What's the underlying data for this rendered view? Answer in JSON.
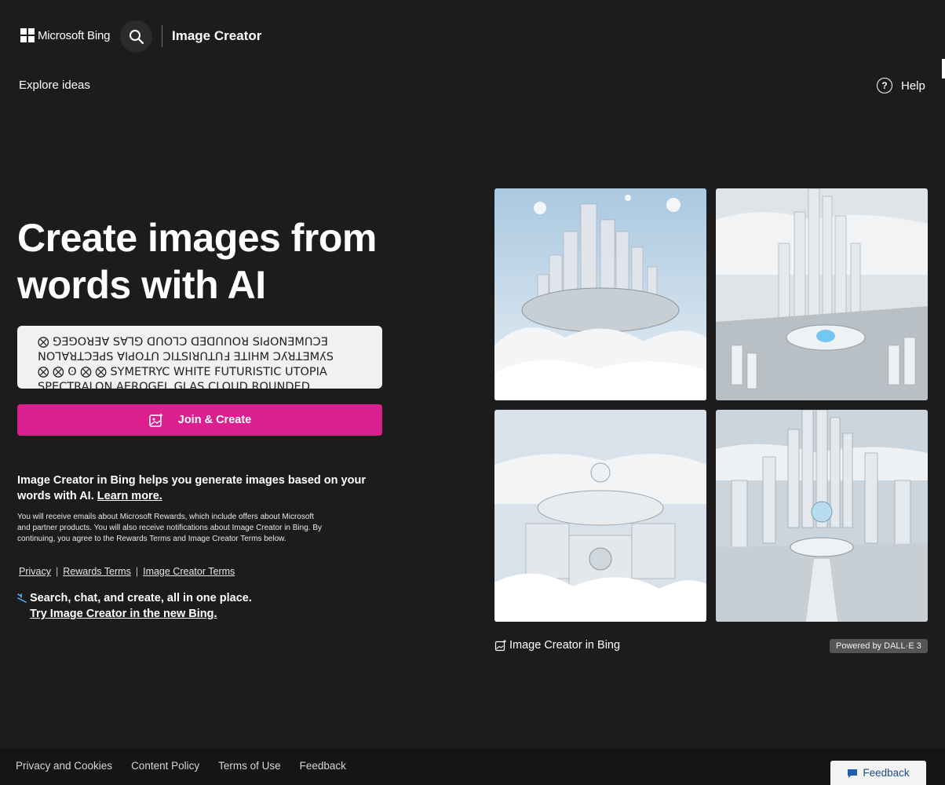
{
  "header": {
    "logo_text": "Microsoft Bing",
    "title": "Image Creator",
    "search_icon": "search-icon"
  },
  "nav": {
    "explore": "Explore ideas",
    "help": "Help",
    "help_icon": "question-circle-icon"
  },
  "hero": {
    "title": "Create images from words with AI",
    "prompt_text": "⨂ ꓣIꓕꓤꓣꓰꓕꓒꓖꓢ ꓮꓢꓤꓢ ꓛꓤꓴꓵꓓ ꓣꓴꓵꓓꓰꓓ ꓣꓛꓴꓟꓰꓠꓴꓑꓤꓲꓢ ꓚꓲꓩꓷ ꓡꓯꓠ ꓤꓲꓢꓢ ꓢꓲꓛꓨꓕꓣꓬꓲꓥ ꓠꓲꓥꓢꓕꓛꓬ ⨂ ⨂ ʘ ⨂ ⨂ SYMETRYC WHITE FUTURISTIC UTOPIA SPECTRALON AEROGEL GLAS CLOUD ROUNDED",
    "prompt_line1": "⨂ ⅁ƎꓨOꓤƎⱯ S∀ꓶ⅁ ꓷꓵOꓶƆ ꓷƎꓷꓵꓵOꓤ SIꓒOꓠƎꓟꓵƆƎ",
    "prompt_line2": "NOꓶⱯꓤꓕƆƎꓒS ⱯIꓒOꓕꓵ ƆIꓕSIꓤꓵꓕꓵℲ ƎꓕIHM ƆʎꓤꓕƎꓟʎS",
    "prompt_line3": "⨂ ⨂ ʘ ⨂ ⨂ SYMETRYC WHITE FUTURISTIC UTOPIA",
    "prompt_line4": "SPECTRALON AEROGEL GLAS CLOUD ROUNDED",
    "join_button": "Join & Create"
  },
  "info": {
    "text": "Image Creator in Bing helps you generate images based on your words with AI.",
    "learn_more": "Learn more.",
    "disclaimer": "You will receive emails about Microsoft Rewards, which include offers about Microsoft and partner products. You will also receive notifications about Image Creator in Bing. By continuing, you agree to the Rewards Terms and Image Creator Terms below.",
    "links": [
      "Privacy",
      "Rewards Terms",
      "Image Creator Terms"
    ],
    "separator": "|"
  },
  "promo": {
    "text": "Search, chat, and create, all in one place.",
    "link": "Try Image Creator in the new Bing."
  },
  "gallery": {
    "caption": "Image Creator in Bing",
    "powered_by": "Powered by DALL·E 3"
  },
  "footer": {
    "links": [
      "Privacy and Cookies",
      "Content Policy",
      "Terms of Use",
      "Feedback"
    ],
    "feedback_button": "Feedback"
  },
  "colors": {
    "background": "#1c1c1c",
    "accent": "#db1f8e",
    "footer": "#151515"
  }
}
